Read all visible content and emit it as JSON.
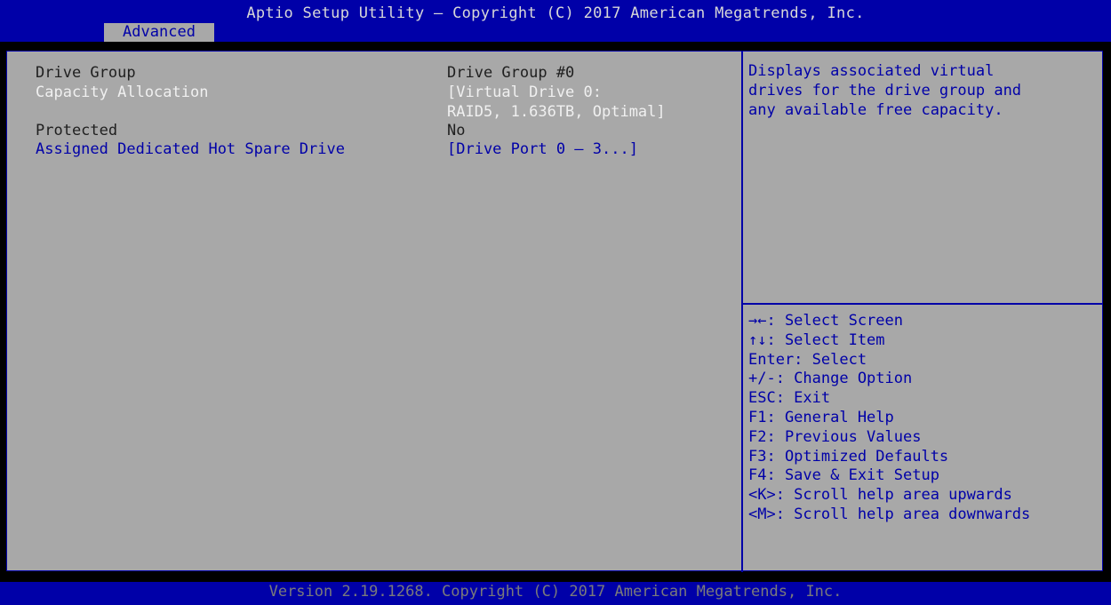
{
  "header": {
    "title": "Aptio Setup Utility – Copyright (C) 2017 American Megatrends, Inc.",
    "active_tab": "Advanced"
  },
  "settings": {
    "drive_group": {
      "label": "Drive Group",
      "value": "Drive Group #0"
    },
    "capacity_allocation": {
      "label": "Capacity Allocation",
      "value_line1": "[Virtual Drive 0:",
      "value_line2": "RAID5, 1.636TB, Optimal]"
    },
    "protected": {
      "label": "Protected",
      "value": "No"
    },
    "hot_spare": {
      "label": "Assigned Dedicated Hot Spare Drive",
      "value": "[Drive Port 0 – 3...]"
    }
  },
  "help": {
    "lines": [
      "Displays associated virtual",
      "drives for the drive group and",
      "any available free capacity."
    ]
  },
  "keys": [
    "→←: Select Screen",
    "↑↓: Select Item",
    "Enter: Select",
    "+/-: Change Option",
    "ESC: Exit",
    "F1: General Help",
    "F2: Previous Values",
    "F3: Optimized Defaults",
    "F4: Save & Exit Setup",
    "<K>: Scroll help area upwards",
    "<M>: Scroll help area downwards"
  ],
  "footer": {
    "text": "Version 2.19.1268. Copyright (C) 2017 American Megatrends, Inc."
  },
  "colors": {
    "bios_blue": "#0000a8",
    "panel_gray": "#a8a8a8",
    "selected_white": "#f0f0f0"
  }
}
